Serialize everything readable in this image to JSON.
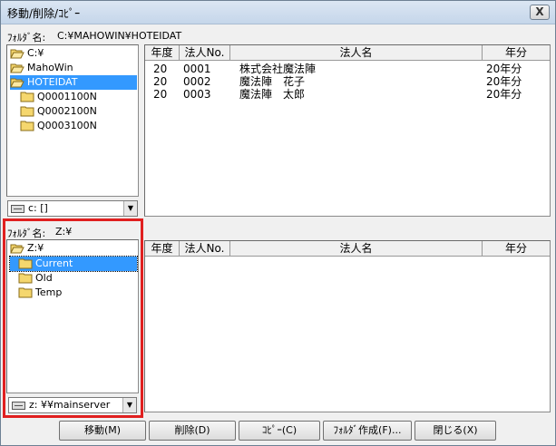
{
  "window": {
    "title": "移動/削除/ｺﾋﾟｰ",
    "close": "X"
  },
  "top": {
    "folder_label": "ﾌｫﾙﾀﾞ名:",
    "folder_path": "C:¥MAHOWIN¥HOTEIDAT",
    "tree": [
      "C:¥",
      "MahoWin",
      "HOTEIDAT",
      "Q0001100N",
      "Q0002100N",
      "Q0003100N"
    ],
    "selected_index": 2,
    "drive": "c: []",
    "columns": [
      "年度",
      "法人No.",
      "法人名",
      "年分"
    ],
    "rows": [
      {
        "year": "20",
        "no": "0001",
        "name": "株式会社魔法陣",
        "period": "20年分"
      },
      {
        "year": "20",
        "no": "0002",
        "name": "魔法陣　花子",
        "period": "20年分"
      },
      {
        "year": "20",
        "no": "0003",
        "name": "魔法陣　太郎",
        "period": "20年分"
      }
    ]
  },
  "bottom": {
    "folder_label": "ﾌｫﾙﾀﾞ名:",
    "folder_path": "Z:¥",
    "tree": [
      "Z:¥",
      "Current",
      "Old",
      "Temp"
    ],
    "selected_index": 1,
    "drive": "z: ¥¥mainserver",
    "columns": [
      "年度",
      "法人No.",
      "法人名",
      "年分"
    ]
  },
  "buttons": {
    "move": "移動(M)",
    "delete": "削除(D)",
    "copy": "ｺﾋﾟｰ(C)",
    "create_folder": "ﾌｫﾙﾀﾞ作成(F)...",
    "close": "閉じる(X)"
  },
  "colors": {
    "selection": "#3399ff",
    "highlight_border": "#e02020",
    "folder": "#f5d76e"
  }
}
